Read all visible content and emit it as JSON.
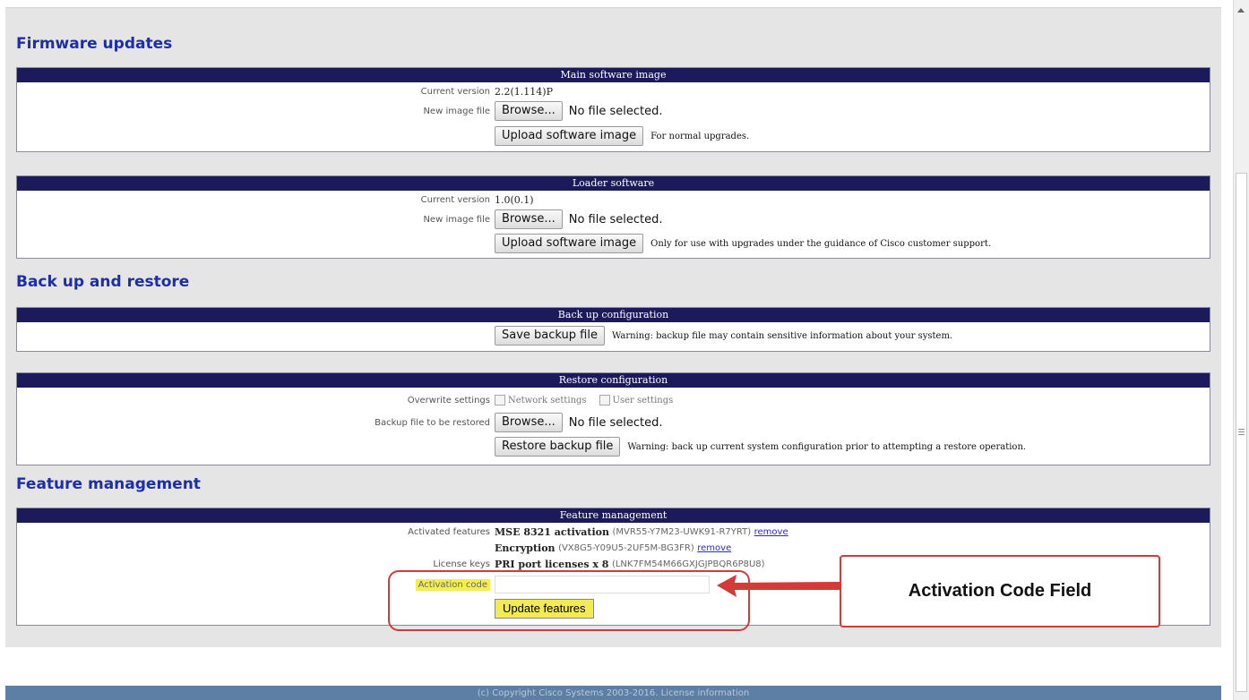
{
  "firmware": {
    "heading": "Firmware updates",
    "main": {
      "header": "Main software image",
      "current_version_label": "Current version",
      "current_version": "2.2(1.114)P",
      "new_image_label": "New image file",
      "browse_label": "Browse...",
      "no_file": "No file selected.",
      "upload_label": "Upload software image",
      "note": "For normal upgrades."
    },
    "loader": {
      "header": "Loader software",
      "current_version_label": "Current version",
      "current_version": "1.0(0.1)",
      "new_image_label": "New image file",
      "browse_label": "Browse...",
      "no_file": "No file selected.",
      "upload_label": "Upload software image",
      "note": "Only for use with upgrades under the guidance of Cisco customer support."
    }
  },
  "backup": {
    "heading": "Back up and restore",
    "backup_config": {
      "header": "Back up configuration",
      "save_label": "Save backup file",
      "note": "Warning: backup file may contain sensitive information about your system."
    },
    "restore_config": {
      "header": "Restore configuration",
      "overwrite_label": "Overwrite settings",
      "network_settings": "Network settings",
      "user_settings": "User settings",
      "file_label": "Backup file to be restored",
      "browse_label": "Browse...",
      "no_file": "No file selected.",
      "restore_label": "Restore backup file",
      "note": "Warning: back up current system configuration prior to attempting a restore operation."
    }
  },
  "features": {
    "heading": "Feature management",
    "header": "Feature management",
    "activated_label": "Activated features",
    "items": [
      {
        "name": "MSE 8321 activation",
        "code": "(MVR55-Y7M23-UWK91-R7YRT)",
        "remove": "remove"
      },
      {
        "name": "Encryption",
        "code": "(VX8G5-Y09U5-2UF5M-BG3FR)",
        "remove": "remove"
      }
    ],
    "license_label": "License keys",
    "license_name": "PRI port licenses x 8",
    "license_code": "(LNK7FM54M66GXJGJPBQR6P8U8)",
    "activation_label": "Activation code",
    "activation_value": "",
    "update_label": "Update features"
  },
  "callout": {
    "text": "Activation Code Field",
    "color": "#d33a38"
  },
  "footer": {
    "text": "(c) Copyright Cisco Systems 2003-2016. License information"
  }
}
